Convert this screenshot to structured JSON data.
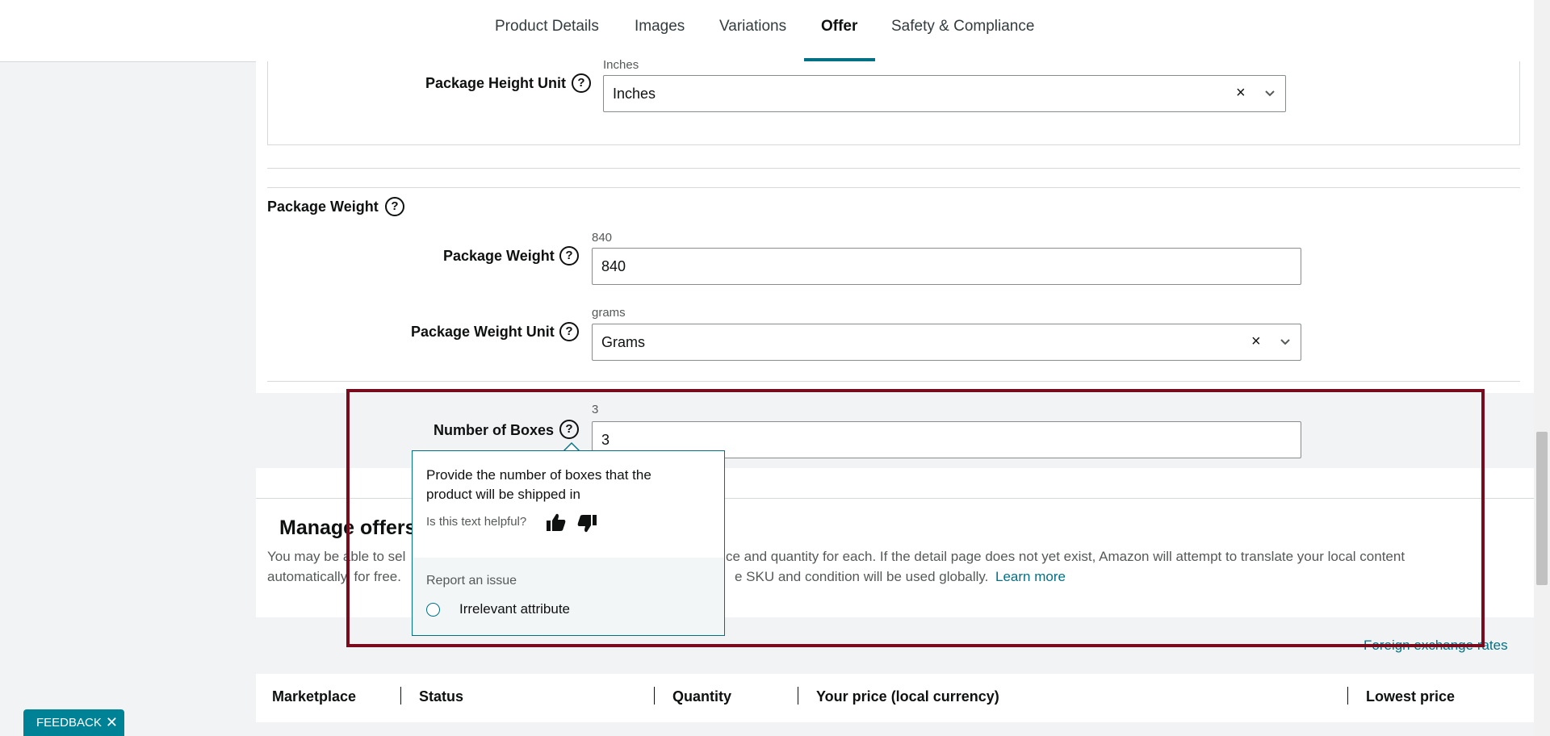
{
  "tabs": [
    {
      "label": "Product Details"
    },
    {
      "label": "Images"
    },
    {
      "label": "Variations"
    },
    {
      "label": "Offer"
    },
    {
      "label": "Safety & Compliance"
    }
  ],
  "package_height_unit": {
    "label": "Package Height Unit",
    "hint": "Inches",
    "value": "Inches"
  },
  "package_weight_section": {
    "title": "Package Weight"
  },
  "package_weight": {
    "label": "Package Weight",
    "hint": "840",
    "value": "840"
  },
  "package_weight_unit": {
    "label": "Package Weight Unit",
    "hint": "grams",
    "value": "Grams"
  },
  "number_of_boxes": {
    "label": "Number of Boxes",
    "hint": "3",
    "value": "3"
  },
  "tooltip": {
    "text": "Provide the number of boxes that the product will be shipped in",
    "helpful_question": "Is this text helpful?",
    "report_heading": "Report an issue",
    "option_label": "Irrelevant attribute"
  },
  "manage_offers": {
    "title": "Manage offers",
    "body_line1_start": "You may be able to sel",
    "body_line1_end": "ce and quantity for each. If the detail page does not yet exist, Amazon will attempt to translate your local content",
    "body_line2_start": "automatically, for free.",
    "body_line2_end": "e SKU and condition will be used globally.",
    "learn_more": "Learn more",
    "fx_link": "Foreign exchange rates"
  },
  "table": {
    "headers": [
      "Marketplace",
      "Status",
      "Quantity",
      "Your price (local currency)",
      "Lowest price"
    ]
  },
  "feedback": {
    "label": "FEEDBACK",
    "close": "✕"
  },
  "colors": {
    "accent": "#007185",
    "highlight": "#7a0b1c",
    "feedback_bg": "#008296"
  }
}
